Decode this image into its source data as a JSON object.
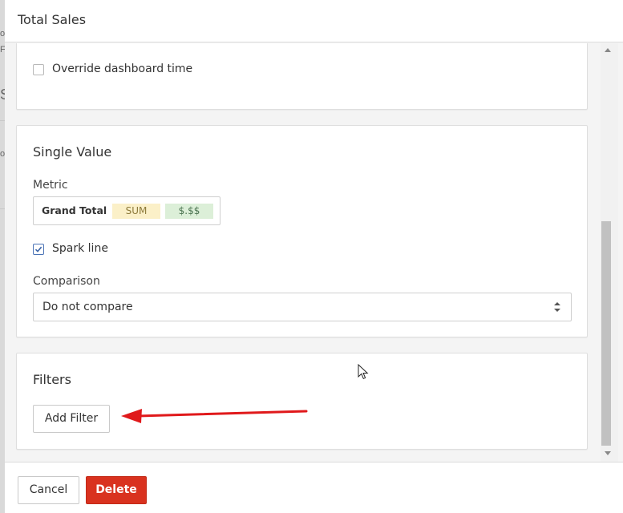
{
  "modal": {
    "title": "Total Sales"
  },
  "time_section": {
    "override_label": "Override dashboard time",
    "override_checked": false
  },
  "single_value": {
    "title": "Single Value",
    "metric_label": "Metric",
    "metric": {
      "name": "Grand Total",
      "aggregation": "SUM",
      "format": "$.$$"
    },
    "spark_line_label": "Spark line",
    "spark_line_checked": true,
    "comparison_label": "Comparison",
    "comparison_value": "Do not compare"
  },
  "filters": {
    "title": "Filters",
    "add_filter_label": "Add Filter"
  },
  "footer": {
    "cancel_label": "Cancel",
    "delete_label": "Delete"
  },
  "colors": {
    "danger": "#d9321f",
    "annotation_arrow": "#e0191b",
    "sum_tag_bg": "#fbf0c8",
    "format_tag_bg": "#dcefd8",
    "checkbox_accent": "#4a73b6"
  },
  "icons": {
    "sort": "up-down-chevron-icon",
    "check": "checkmark-icon",
    "cursor": "mouse-pointer-icon",
    "annotation": "red-arrow-annotation"
  }
}
